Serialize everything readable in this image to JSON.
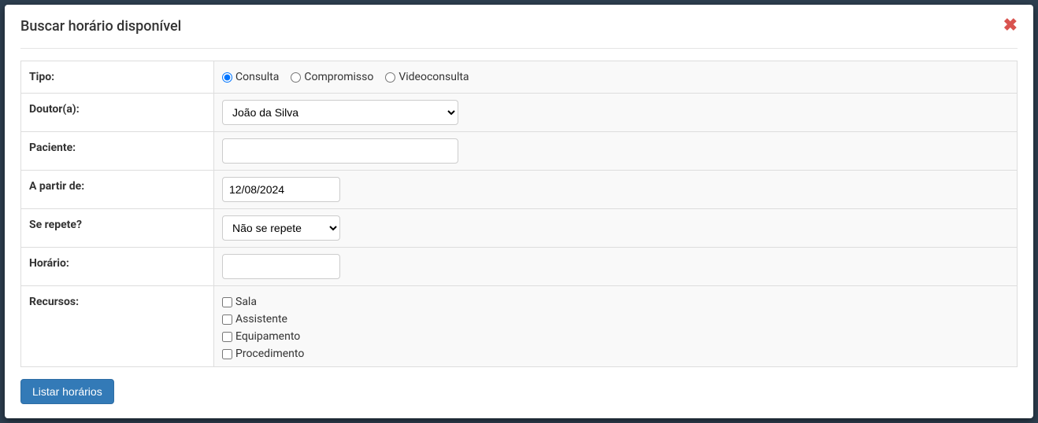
{
  "header": {
    "title": "Buscar horário disponível"
  },
  "form": {
    "tipo": {
      "label": "Tipo:",
      "options": {
        "consulta": "Consulta",
        "compromisso": "Compromisso",
        "videoconsulta": "Videoconsulta"
      },
      "selected": "consulta"
    },
    "doutor": {
      "label": "Doutor(a):",
      "value": "João da Silva"
    },
    "paciente": {
      "label": "Paciente:",
      "value": ""
    },
    "apartir": {
      "label": "A partir de:",
      "value": "12/08/2024"
    },
    "repete": {
      "label": "Se repete?",
      "value": "Não se repete"
    },
    "horario": {
      "label": "Horário:",
      "value": ""
    },
    "recursos": {
      "label": "Recursos:",
      "options": {
        "sala": "Sala",
        "assistente": "Assistente",
        "equipamento": "Equipamento",
        "procedimento": "Procedimento"
      }
    }
  },
  "actions": {
    "list": "Listar horários"
  }
}
